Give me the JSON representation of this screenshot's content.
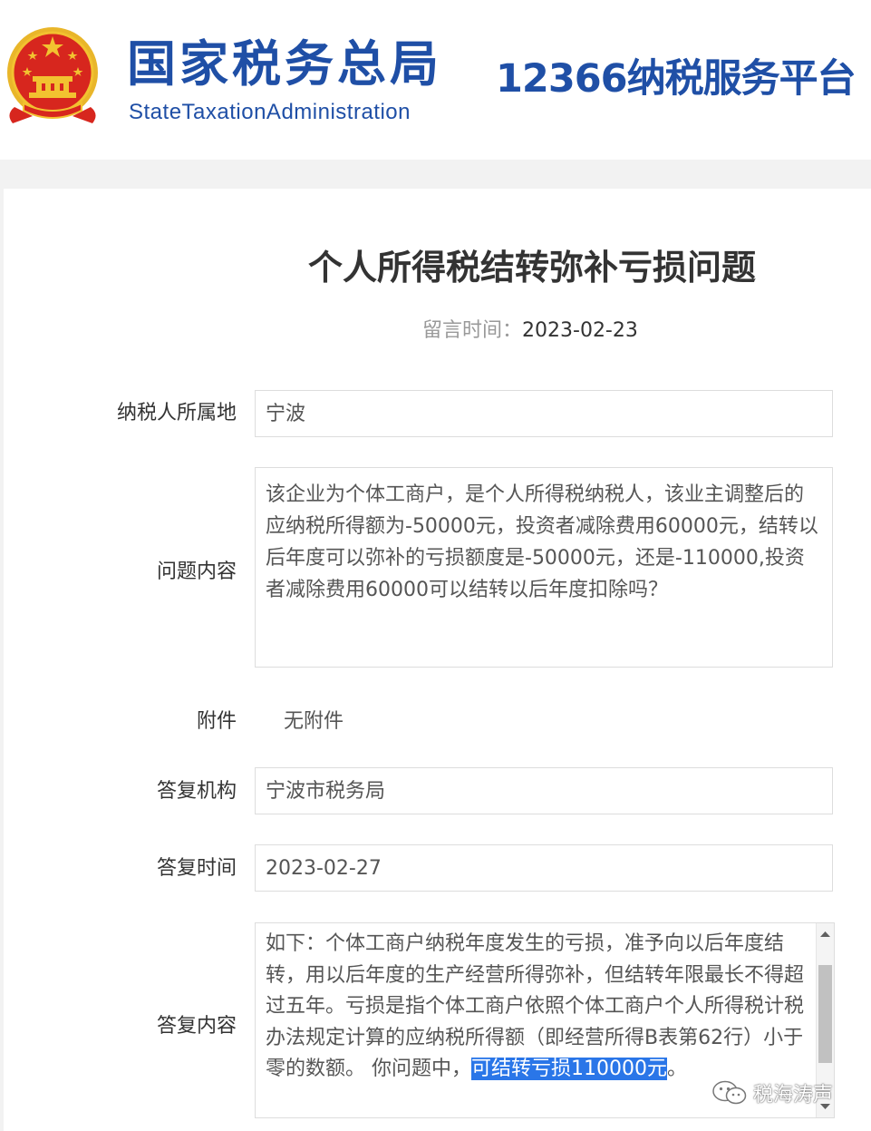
{
  "header": {
    "logo_cn": "国家税务总局",
    "logo_en": "StateTaxationAdministration",
    "platform": "12366纳税服务平台"
  },
  "page": {
    "title": "个人所得税结转弥补亏损问题",
    "message_time_label": "留言时间：",
    "message_time": "2023-02-23"
  },
  "form": {
    "location_label": "纳税人所属地",
    "location_value": "宁波",
    "question_label": "问题内容",
    "question_value": "该企业为个体工商户，是个人所得税纳税人，该业主调整后的应纳税所得额为-50000元，投资者减除费用60000元，结转以后年度可以弥补的亏损额度是-50000元，还是-110000,投资者减除费用60000可以结转以后年度扣除吗？",
    "attachment_label": "附件",
    "attachment_value": "无附件",
    "agency_label": "答复机构",
    "agency_value": "宁波市税务局",
    "reply_time_label": "答复时间",
    "reply_time_value": "2023-02-27",
    "reply_label": "答复内容",
    "reply_text": "如下：个体工商户纳税年度发生的亏损，准予向以后年度结转，用以后年度的生产经营所得弥补，但结转年限最长不得超过五年。亏损是指个体工商户依照个体工商户个人所得税计税办法规定计算的应纳税所得额（即经营所得B表第62行）小于零的数额。 你问题中，",
    "reply_highlight": "可结转亏损110000元",
    "reply_tail": "。"
  },
  "watermark": {
    "text": "税海涛声",
    "icon": "wechat-icon"
  },
  "colors": {
    "brand_blue": "#1f4fa6",
    "highlight": "#2a76e8",
    "emblem_red": "#d7261e",
    "emblem_gold": "#f2c230"
  }
}
